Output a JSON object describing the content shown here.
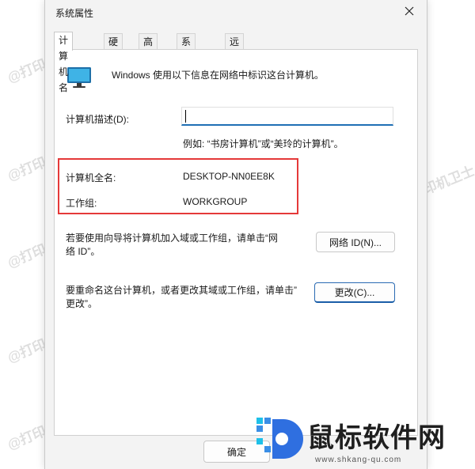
{
  "dialog": {
    "title": "系统属性",
    "tabs": [
      "计算机名",
      "硬件",
      "高级",
      "系统保护",
      "远程"
    ],
    "active_tab": "计算机名",
    "intro_text": "Windows 使用以下信息在网络中标识这台计算机。",
    "description_label": "计算机描述(D):",
    "description_value": "",
    "description_hint": "例如: “书房计算机”或“美玲的计算机”。",
    "full_name_label": "计算机全名:",
    "full_name_value": "DESKTOP-NN0EE8K",
    "workgroup_label": "工作组:",
    "workgroup_value": "WORKGROUP",
    "network_text_line1": "若要使用向导将计算机加入域或工作组，请单击“网",
    "network_text_line2": "络 ID”。",
    "network_button": "网络 ID(N)...",
    "rename_text_line1": "要重命名这台计算机，或者更改其域或工作组，请单击”",
    "rename_text_line2": "更改”。",
    "change_button": "更改(C)...",
    "ok_button": "确定"
  },
  "watermark_text": "@打印机卫士",
  "logo": {
    "text": "鼠标软件网",
    "url": "www.shkang-qu.com"
  },
  "colors": {
    "highlight": "#e53939",
    "accent": "#1f6fb5"
  }
}
